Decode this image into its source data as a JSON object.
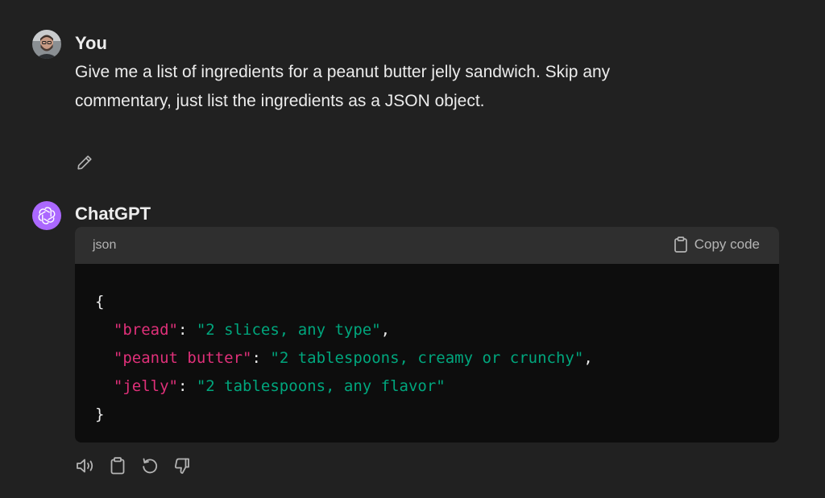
{
  "user_message": {
    "author": "You",
    "text": "Give me a list of ingredients for a peanut butter jelly sandwich. Skip any commentary, just list the ingredients as a JSON object."
  },
  "assistant_message": {
    "author": "ChatGPT",
    "code_block": {
      "language": "json",
      "copy_label": "Copy code",
      "lines": {
        "open": "{",
        "l1_key": "\"bread\"",
        "l1_sep": ": ",
        "l1_val": "\"2 slices, any type\"",
        "l1_end": ",",
        "l2_key": "\"peanut butter\"",
        "l2_sep": ": ",
        "l2_val": "\"2 tablespoons, creamy or crunchy\"",
        "l2_end": ",",
        "l3_key": "\"jelly\"",
        "l3_sep": ": ",
        "l3_val": "\"2 tablespoons, any flavor\"",
        "close": "}"
      }
    }
  },
  "icons": {
    "edit": "pencil-icon",
    "read_aloud": "speaker-icon",
    "copy": "clipboard-icon",
    "regenerate": "regenerate-icon",
    "dislike": "thumbs-down-icon"
  },
  "colors": {
    "background": "#212121",
    "code_header": "#2f2f2f",
    "code_body": "#0d0d0d",
    "json_key": "#df3079",
    "json_string": "#00a67d",
    "assistant_avatar": "#ab68ff"
  }
}
